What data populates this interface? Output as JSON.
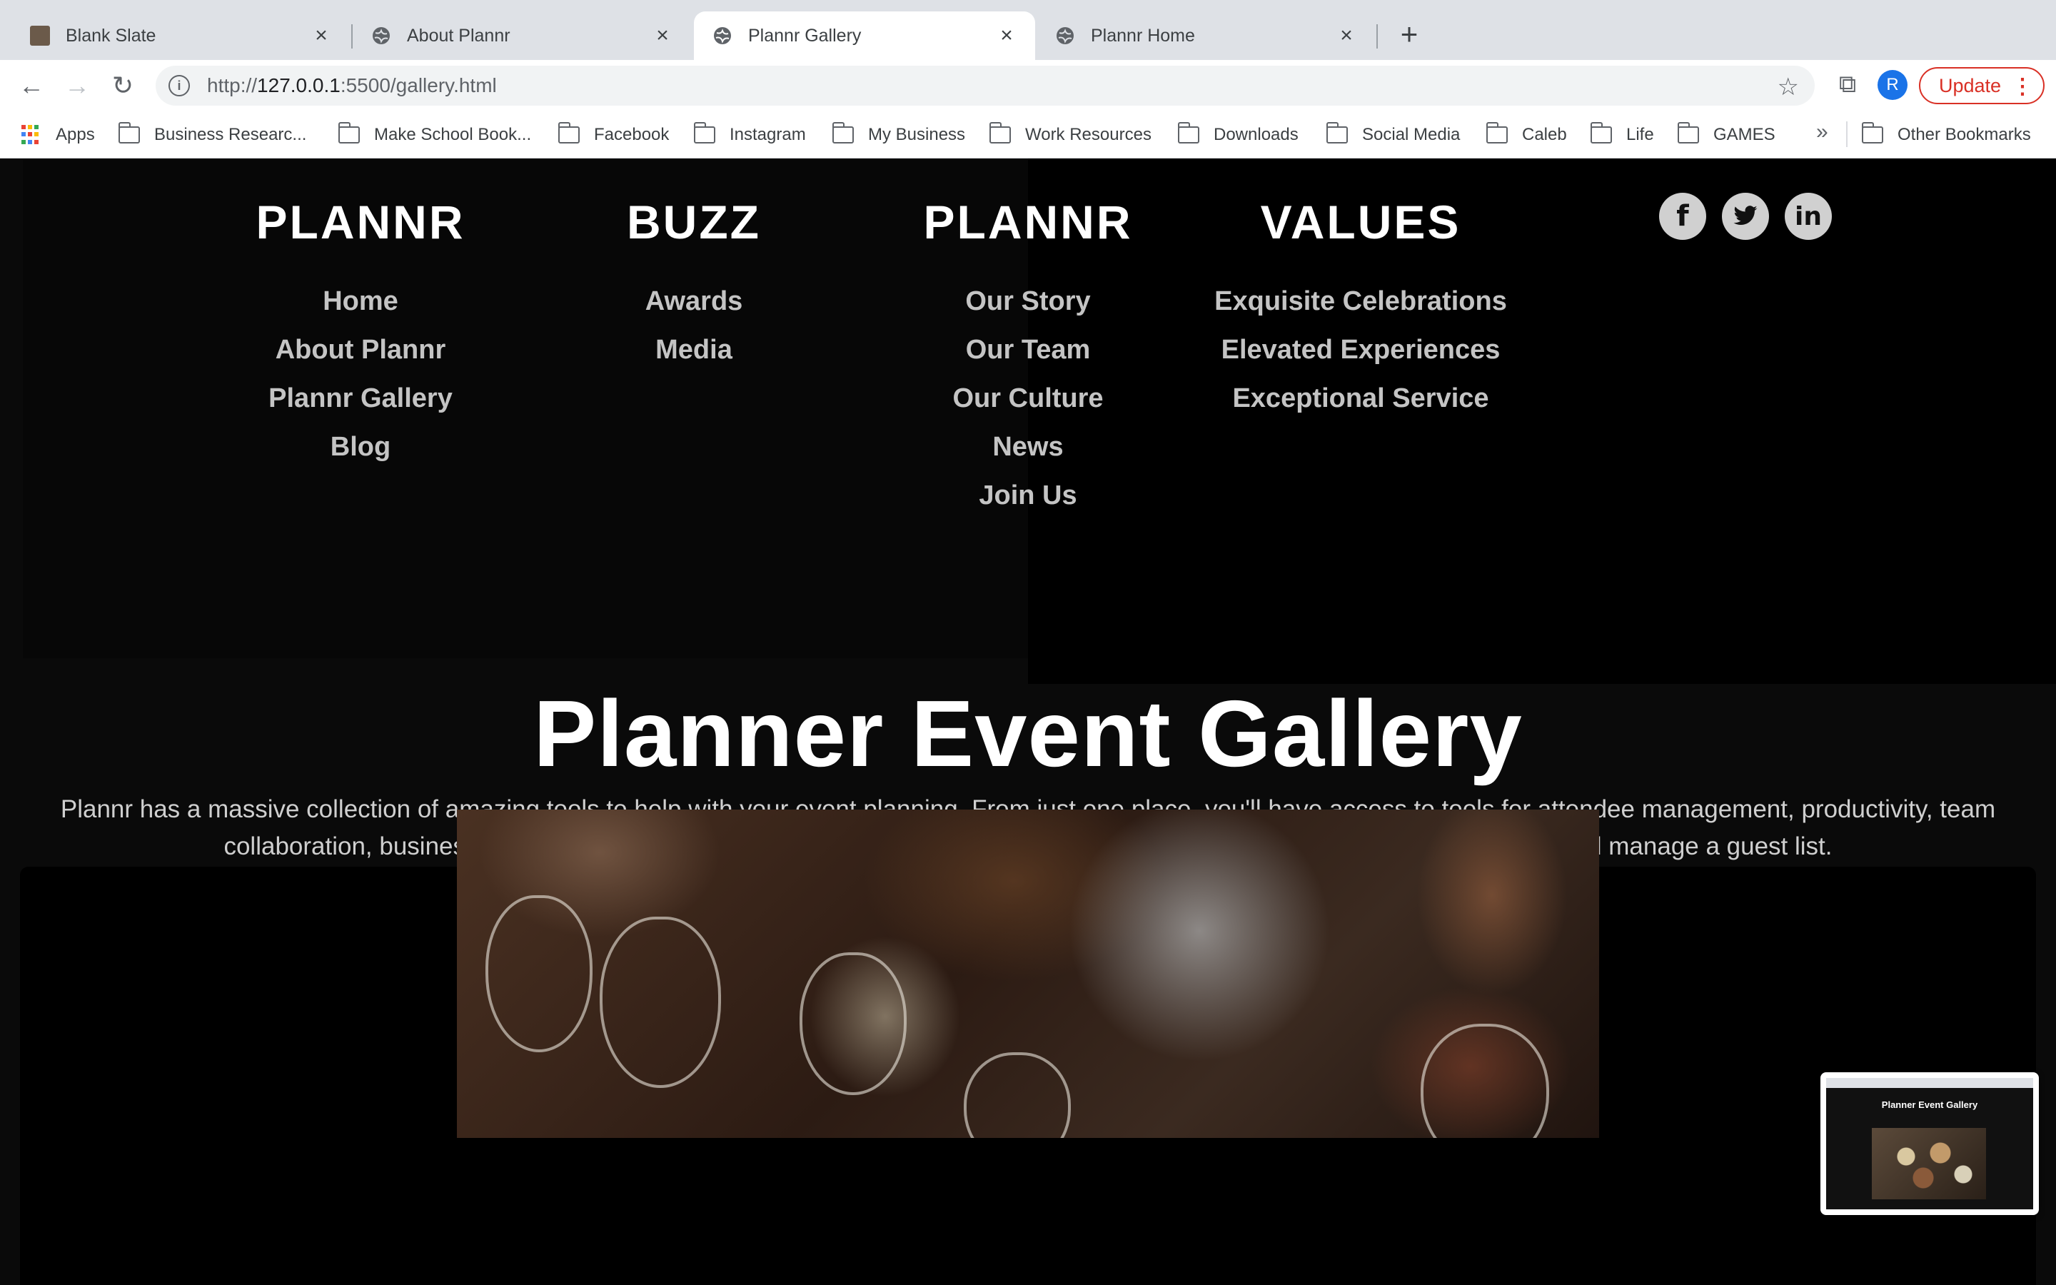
{
  "browser": {
    "tabs": [
      {
        "title": "Blank Slate",
        "active": false
      },
      {
        "title": "About Plannr",
        "active": false
      },
      {
        "title": "Plannr Gallery",
        "active": true
      },
      {
        "title": "Plannr Home",
        "active": false
      }
    ],
    "url_prefix": "http://",
    "url_host": "127.0.0.1",
    "url_path": ":5500/gallery.html",
    "avatar_letter": "R",
    "update_label": "Update",
    "bookmarks": [
      "Apps",
      "Business Researc...",
      "Make School Book...",
      "Facebook",
      "Instagram",
      "My Business",
      "Work Resources",
      "Downloads",
      "Social Media",
      "Caleb",
      "Life",
      "GAMES"
    ],
    "more_bookmarks": "»",
    "other_bookmarks": "Other Bookmarks",
    "apps_colors": [
      "#ea4335",
      "#fbbc04",
      "#34a853",
      "#4285f4",
      "#ea4335",
      "#fbbc04",
      "#34a853",
      "#4285f4",
      "#ea4335"
    ]
  },
  "footer": {
    "columns": [
      {
        "heading": "PLANNR",
        "links": [
          "Home",
          "About Plannr",
          "Plannr Gallery",
          "Blog"
        ]
      },
      {
        "heading": "BUZZ",
        "links": [
          "Awards",
          "Media"
        ]
      },
      {
        "heading": "PLANNR",
        "links": [
          "Our Story",
          "Our Team",
          "Our Culture",
          "News",
          "Join Us"
        ]
      },
      {
        "heading": "VALUES",
        "links": [
          "Exquisite Celebrations",
          "Elevated Experiences",
          "Exceptional Service"
        ]
      }
    ],
    "social": [
      {
        "name": "facebook-icon",
        "glyph": "f"
      },
      {
        "name": "twitter-icon",
        "glyph": "🐦"
      },
      {
        "name": "linkedin-icon",
        "glyph": "in"
      }
    ]
  },
  "gallery": {
    "title": "Planner Event Gallery",
    "description": "Plannr has a massive collection of amazing tools to help with your event planning. From just one place, you'll have access to tools for attendee management, productivity, team collaboration, business management, and customization. You can arrange seating, register guests, build event websites, and manage a guest list."
  },
  "thumbnail": {
    "title": "Planner Event Gallery"
  }
}
